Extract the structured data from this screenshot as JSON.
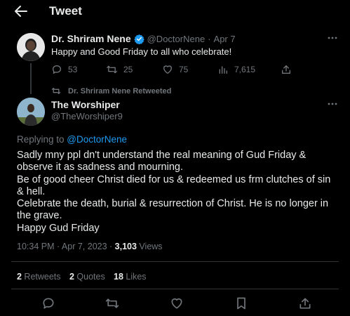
{
  "header": {
    "title": "Tweet"
  },
  "original_tweet": {
    "name": "Dr. Shriram Nene",
    "handle": "@DoctorNene",
    "separator": "·",
    "date": "Apr 7",
    "text": "Happy and Good Friday to all who celebrate!",
    "replies": "53",
    "retweets": "25",
    "likes": "75",
    "views": "7,615"
  },
  "retweet_notice": {
    "text": "Dr. Shriram Nene Retweeted"
  },
  "main_tweet": {
    "name": "The Worshiper",
    "handle": "@TheWorshiper9",
    "replying_prefix": "Replying to ",
    "replying_to": "@DoctorNene",
    "text": "Sadly mny ppl dn't understand the real meaning of Gud Friday & observe it as  sadness and mourning.\nBe of good cheer Christ died for us & redeemed us frm clutches of sin & hell.\nCelebrate the death, burial & resurrection of Christ. He is no longer in the grave.\nHappy Gud Friday",
    "timestamp": "10:34 PM · Apr 7, 2023 · ",
    "views_count": "3,103",
    "views_label": " Views",
    "retweets_count": "2",
    "retweets_label": " Retweets",
    "quotes_count": "2",
    "quotes_label": " Quotes",
    "likes_count": "18",
    "likes_label": " Likes"
  },
  "colors": {
    "background": "#000000",
    "text": "#e7e9ea",
    "muted": "#71767b",
    "accent": "#1d9bf0",
    "divider": "#2f3336"
  },
  "icons": [
    "back-arrow-icon",
    "verified-badge-icon",
    "more-icon",
    "reply-icon",
    "retweet-icon",
    "like-icon",
    "views-icon",
    "share-icon",
    "bookmark-icon"
  ]
}
